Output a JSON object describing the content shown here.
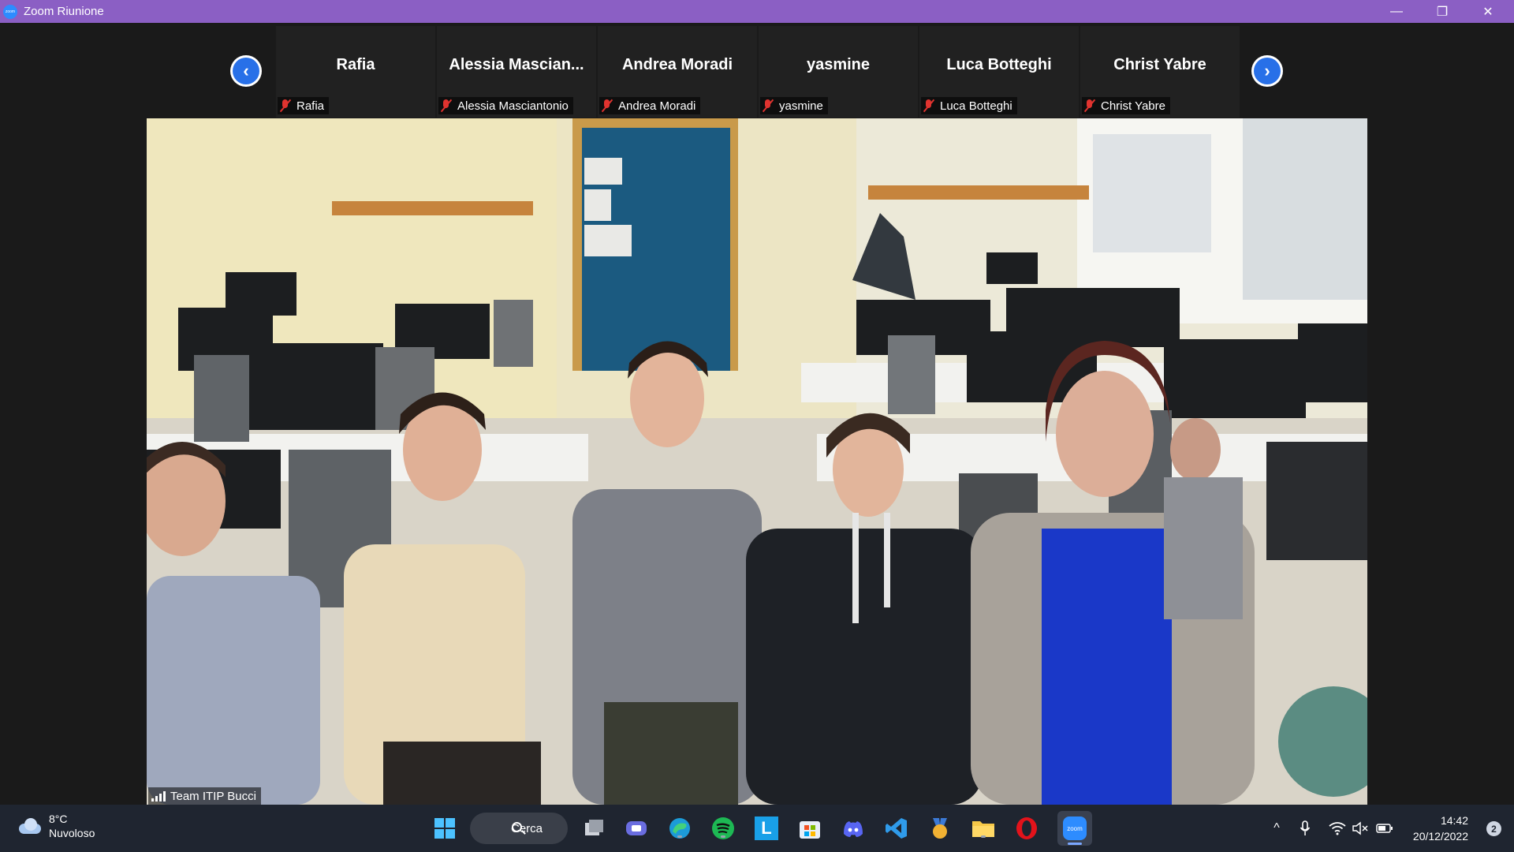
{
  "window": {
    "title": "Zoom Riunione",
    "app_icon_text": "zoom",
    "controls": {
      "minimize": "—",
      "restore": "❐",
      "close": "✕"
    }
  },
  "participants_strip": {
    "prev_symbol": "‹",
    "next_symbol": "›",
    "tiles": [
      {
        "display_name": "Rafia",
        "label": "Rafia",
        "muted": true
      },
      {
        "display_name": "Alessia  Mascian...",
        "label": "Alessia Masciantonio",
        "muted": true
      },
      {
        "display_name": "Andrea Moradi",
        "label": "Andrea Moradi",
        "muted": true
      },
      {
        "display_name": "yasmine",
        "label": "yasmine",
        "muted": true
      },
      {
        "display_name": "Luca Botteghi",
        "label": "Luca Botteghi",
        "muted": true
      },
      {
        "display_name": "Christ Yabre",
        "label": "Christ Yabre",
        "muted": true
      }
    ]
  },
  "active_speaker": {
    "label": "Team ITIP Bucci",
    "connection_icon": "signal-bars-icon"
  },
  "taskbar": {
    "weather": {
      "temp": "8°C",
      "condition": "Nuvoloso",
      "icon": "cloud-icon"
    },
    "search_label": "Cerca",
    "apps": [
      {
        "name": "start",
        "icon": "windows-icon"
      },
      {
        "name": "task-view",
        "icon": "task-view-icon"
      },
      {
        "name": "teams-chat",
        "icon": "chat-icon"
      },
      {
        "name": "edge",
        "icon": "edge-icon"
      },
      {
        "name": "spotify",
        "icon": "spotify-icon"
      },
      {
        "name": "l-app",
        "icon": "l-app-icon",
        "text": "L"
      },
      {
        "name": "store",
        "icon": "store-icon"
      },
      {
        "name": "discord",
        "icon": "discord-icon"
      },
      {
        "name": "vscode",
        "icon": "vscode-icon"
      },
      {
        "name": "medal-app",
        "icon": "medal-icon"
      },
      {
        "name": "file-explorer",
        "icon": "folder-icon"
      },
      {
        "name": "opera",
        "icon": "opera-icon",
        "text": "O"
      },
      {
        "name": "zoom",
        "icon": "zoom-icon",
        "text": "zoom"
      }
    ],
    "tray": {
      "chevron": "^",
      "mic": "🎙",
      "wifi": "wifi-icon",
      "volume": "🔇",
      "battery": "battery-icon"
    },
    "clock": {
      "time": "14:42",
      "date": "20/12/2022"
    },
    "notifications": "2"
  },
  "colors": {
    "titlebar": "#8b5fc4",
    "nav_button": "#2870e8",
    "mute_red": "#e0332f",
    "taskbar": "#1f2530"
  }
}
